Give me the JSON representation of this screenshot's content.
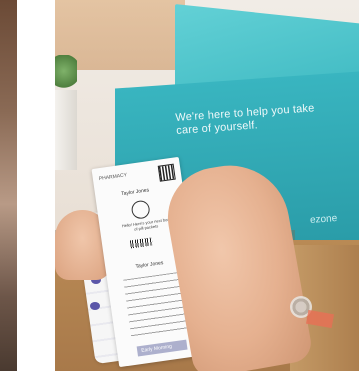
{
  "image": {
    "slogan": "We're here to help you take care of yourself.",
    "brand": "ezone",
    "ticket": {
      "header": "PHARMACY",
      "name": "Taylor Jones",
      "message": "Hello! Here's your next box of pill packets",
      "name_lower": "Taylor Jones",
      "footer": "Early Morning"
    }
  }
}
